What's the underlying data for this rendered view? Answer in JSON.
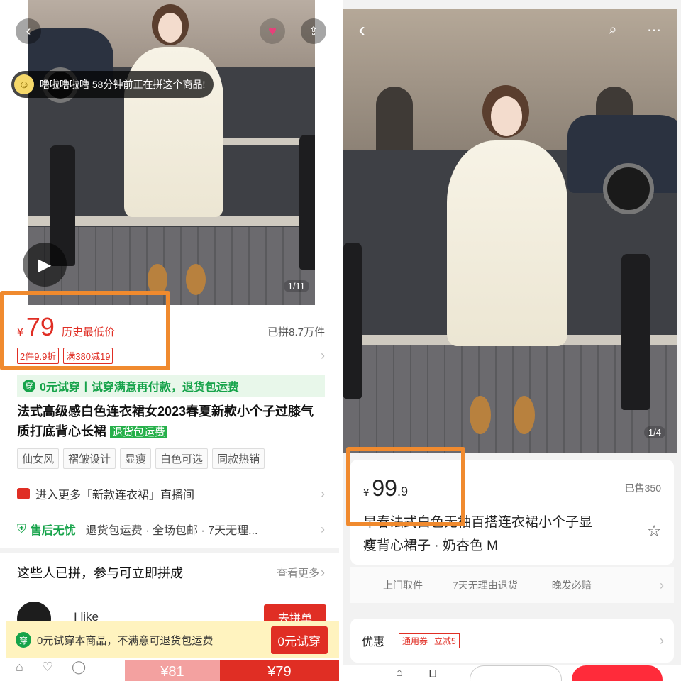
{
  "left": {
    "photo_counter": "1/11",
    "notice_text": "噜啦噜啦噜 58分钟前正在拼这个商品!",
    "notice_avatar_glyph": "☺",
    "price_symbol": "¥",
    "price": "79",
    "price_note": "历史最低价",
    "sold": "已拼8.7万件",
    "tags": [
      "2件9.9折",
      "满380减19"
    ],
    "trial_banner": "0元试穿丨试穿满意再付款，退货包运费",
    "title": "法式高级感白色连衣裙女2023春夏新款小个子过膝气质打底背心长裙",
    "title_tag": "退货包运费",
    "chips": [
      "仙女风",
      "褶皱设计",
      "显瘦",
      "白色可选",
      "同款热销"
    ],
    "live_text": "进入更多「新款连衣裙」直播间",
    "after_sale_label": "售后无忧",
    "after_sale_items": "退货包运费 · 全场包邮 · 7天无理...",
    "group_title": "这些人已拼，参与可立即拼成",
    "see_more": "查看更多",
    "group_user": "I like",
    "group_button": "去拼单",
    "trial_bar_text": "0元试穿本商品，不满意可退货包运费",
    "trial_bar_button": "0元试穿",
    "buy_alone": "¥81",
    "buy_group": "¥79",
    "accent": "#e02e24",
    "highlight": "#f08a2e"
  },
  "right": {
    "photo_counter": "1/4",
    "price_symbol": "¥",
    "price_int": "99",
    "price_dec": ".9",
    "sold": "已售350",
    "title_line1": "早春法式白色无袖百搭连衣裙小个子显",
    "title_line2": "瘦背心裙子 · 奶杏色 M",
    "services": [
      "上门取件",
      "7天无理由退货",
      "晚发必赔"
    ],
    "promo_label": "优惠",
    "coupon_a": "通用券",
    "coupon_b": "立减5"
  }
}
